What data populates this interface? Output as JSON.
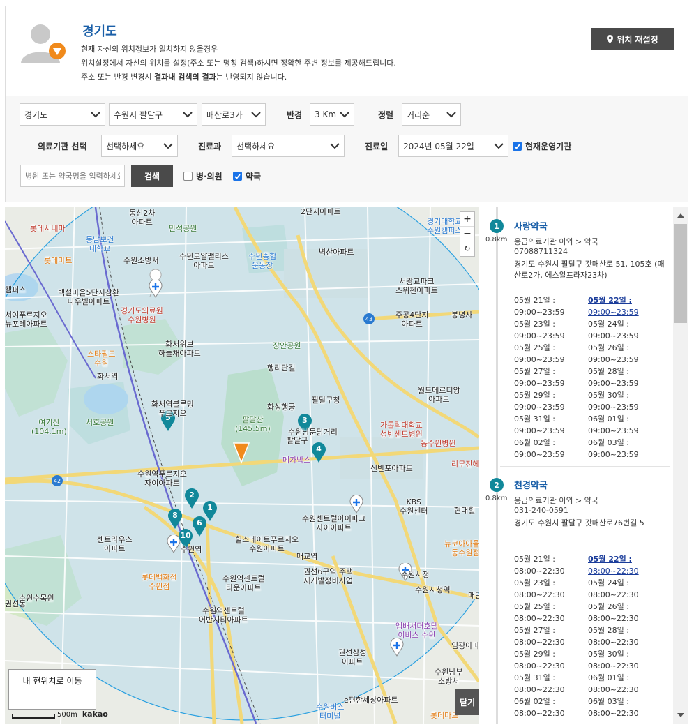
{
  "location": {
    "title": "경기도",
    "desc_line1": "현재 자신의 위치정보가 일치하지 않을경우",
    "desc_line2": "위치설정에서 자신의 위치를 설정(주소 또는 명칭 검색)하시면 정확한 주변 정보를 제공해드립니다.",
    "desc_line3_pre": "주소 또는 반경 변경시 ",
    "desc_line3_bold": "결과내 검색의 결과",
    "desc_line3_post": "는 반영되지 않습니다.",
    "reset_label": "위치 재설정"
  },
  "filters": {
    "province": "경기도",
    "city": "수원시 팔달구",
    "road": "매산로3가",
    "radius_label": "반경",
    "radius": "3 Km",
    "sort_label": "정렬",
    "sort": "거리순",
    "inst_label": "의료기관 선택",
    "inst": "선택하세요",
    "dept_label": "진료과",
    "dept": "선택하세요",
    "date_label": "진료일",
    "date": "2024년 05월 22일",
    "open_now_label": "현재운영기관",
    "search_placeholder": "병원 또는 약국명을 입력하세요",
    "search_label": "검색",
    "hospital_label": "병·의원",
    "pharmacy_label": "약국"
  },
  "map": {
    "zoom_in": "+",
    "zoom_out": "−",
    "refresh": "↻",
    "my_location": "내 현위치로 이동",
    "scale": "500m",
    "brand": "kakao",
    "close": "닫기",
    "labels": {
      "l1": "동신2차\n아파트",
      "l2": "만석공원",
      "l3": "롯데시네마",
      "l4": "동남보건\n대학교",
      "l5": "롯데마트",
      "l6": "수원소방서",
      "l7": "수원로얄팰리스\n아파트",
      "l8": "수원종합\n운동장",
      "l9": "벽산아파트",
      "l10": "2단지아파트",
      "l11": "경기대학교\n수원캠퍼스",
      "l12": "백설마을5단지삼환\n나우빌아파트",
      "l13": "경기도의료원\n수원병원",
      "l14": "서광교파크\n스위첸아파트",
      "l15": "서여푸르지오\n뉴포레아파트",
      "l16": "주공4단지\n아파트",
      "l17": "봉녕사",
      "l18": "화서위브\n하늘채아파트",
      "l19": "장안공원",
      "l20": "스타필드\n수원",
      "l21": "행리단길",
      "l22": "화서역",
      "l23": "팔달구청",
      "l24": "월드메르디앙\n아파트",
      "l25": "화서역블루밍\n푸르지오",
      "l26": "화성행궁",
      "l27": "여기산\n(104.1m)",
      "l28": "서호공원",
      "l29": "팔달산\n(145.5m)",
      "l30": "수원남문닭거리",
      "l31": "팔달구",
      "l32": "가톨릭대학교\n성빈센트병원",
      "l33": "동수원병원",
      "l34": "메가박스",
      "l35": "신반포아파트",
      "l36": "수원역푸르지오\n자이아파트",
      "l37": "KBS\n수원센터",
      "l38": "현대힐",
      "l39": "수원센트럴아이파크\n자이아파트",
      "l40": "센트라우스\n아파트",
      "l41": "수원역",
      "l42": "힐스테이트푸르지오\n수원아파트",
      "l43": "매교역",
      "l44": "뉴코아아울렛\n동수원점",
      "l45": "롯데백화점\n수원점",
      "l46": "권선6구역 주택\n재개발정비사업",
      "l47": "수원시청",
      "l48": "수원역센트럴\n타운아파트",
      "l49": "수원시청역",
      "l50": "수원수목원",
      "l51": "권선동",
      "l52": "수원역센트럴\n어반시티아파트",
      "l53": "엠배서더호텔\n이비스 수원",
      "l54": "임광아파트",
      "l55": "권선삼성\n아파트",
      "l56": "수원남부\n소방서",
      "l57": "e편한세상아파트",
      "l58": "롯데마트",
      "l59": "수원버스\n터미널",
      "l60": "매탄",
      "l61": "리무진헤어",
      "l62": "화서역",
      "l63": "캠퍼스"
    }
  },
  "pharmacies": [
    {
      "num": "1",
      "dist": "0.8km",
      "name": "사랑약국",
      "category": "응급의료기관 이외 > 약국",
      "tel": "07088711324",
      "address": "경기도 수원시 팔달구 갓매산로 51, 105호 (매산로2가, 에스알프라자23차)",
      "hours": [
        {
          "day": "05월 21일 :",
          "time": "09:00~23:59"
        },
        {
          "day": "05월 22일 :",
          "time": "09:00~23:59",
          "today": true
        },
        {
          "day": "05월 23일 :",
          "time": "09:00~23:59"
        },
        {
          "day": "05월 24일 :",
          "time": "09:00~23:59"
        },
        {
          "day": "05월 25일 :",
          "time": "09:00~23:59"
        },
        {
          "day": "05월 26일 :",
          "time": "09:00~23:59"
        },
        {
          "day": "05월 27일 :",
          "time": "09:00~23:59"
        },
        {
          "day": "05월 28일 :",
          "time": "09:00~23:59"
        },
        {
          "day": "05월 29일 :",
          "time": "09:00~23:59"
        },
        {
          "day": "05월 30일 :",
          "time": "09:00~23:59"
        },
        {
          "day": "05월 31일 :",
          "time": "09:00~23:59"
        },
        {
          "day": "06월 01일 :",
          "time": "09:00~23:59"
        },
        {
          "day": "06월 02일 :",
          "time": "09:00~23:59"
        },
        {
          "day": "06월 03일 :",
          "time": "09:00~23:59"
        }
      ]
    },
    {
      "num": "2",
      "dist": "0.8km",
      "name": "천경약국",
      "category": "응급의료기관 이외 > 약국",
      "tel": "031-240-0591",
      "address": "경기도 수원시 팔달구 갓매산로76번길 5",
      "hours": [
        {
          "day": "05월 21일 :",
          "time": "08:00~22:30"
        },
        {
          "day": "05월 22일 :",
          "time": "08:00~22:30",
          "today": true
        },
        {
          "day": "05월 23일 :",
          "time": "08:00~22:30"
        },
        {
          "day": "05월 24일 :",
          "time": "08:00~22:30"
        },
        {
          "day": "05월 25일 :",
          "time": "08:00~22:30"
        },
        {
          "day": "05월 26일 :",
          "time": "08:00~22:30"
        },
        {
          "day": "05월 27일 :",
          "time": "08:00~22:30"
        },
        {
          "day": "05월 28일 :",
          "time": "08:00~22:30"
        },
        {
          "day": "05월 29일 :",
          "time": "08:00~22:30"
        },
        {
          "day": "05월 30일 :",
          "time": "08:00~22:30"
        },
        {
          "day": "05월 31일 :",
          "time": "08:00~22:30"
        },
        {
          "day": "06월 01일 :",
          "time": "08:00~22:30"
        },
        {
          "day": "06월 02일 :",
          "time": "08:00~22:30"
        },
        {
          "day": "06월 03일 :",
          "time": "08:00~22:30"
        }
      ]
    }
  ],
  "markers": [
    "1",
    "2",
    "3",
    "4",
    "5",
    "6",
    "8",
    "10"
  ],
  "colors": {
    "accent": "#1a5fa8",
    "marker": "#11889a",
    "mypos": "#f08a1c",
    "button": "#4a4a4a",
    "checkbox": "#1a73e8"
  },
  "icons": [
    "location-pin-icon",
    "chevron-down-icon",
    "checkbox-checked-icon",
    "user-avatar-icon",
    "hospital-cross-icon",
    "refresh-icon"
  ]
}
